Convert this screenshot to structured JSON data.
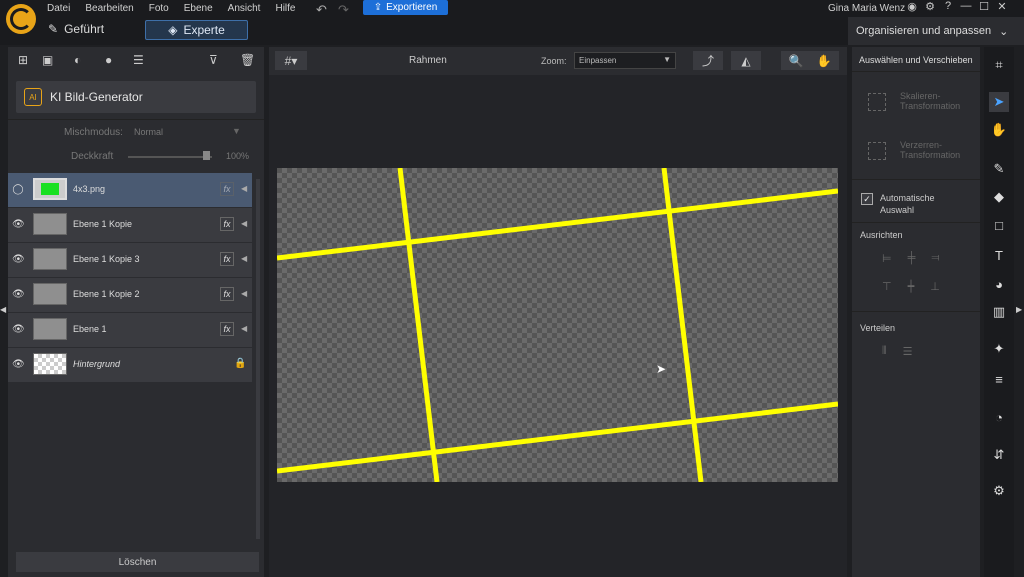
{
  "menu": {
    "items": [
      "Datei",
      "Bearbeiten",
      "Foto",
      "Ebene",
      "Ansicht",
      "Hilfe"
    ],
    "undo_icon": "undo-icon",
    "redo_icon": "redo-icon",
    "export_label": "Exportieren",
    "user_name": "Gina Maria Wenz"
  },
  "modes": {
    "guided": "Geführt",
    "expert": "Experte",
    "organize": "Organisieren und anpassen"
  },
  "left_panel": {
    "ki_button": "KI Bild-Generator",
    "ki_badge": "AI",
    "blend_label": "Mischmodus:",
    "blend_value": "Normal",
    "opacity_label": "Deckkraft",
    "opacity_value": "100%",
    "opacity_fraction": 1.0,
    "delete_label": "Löschen",
    "layers": [
      {
        "name": "4x3.png",
        "selected": true,
        "fx": "fx"
      },
      {
        "name": "Ebene 1 Kopie",
        "selected": false,
        "fx": "fx"
      },
      {
        "name": "Ebene 1 Kopie 3",
        "selected": false,
        "fx": "fx"
      },
      {
        "name": "Ebene 1 Kopie 2",
        "selected": false,
        "fx": "fx"
      },
      {
        "name": "Ebene 1",
        "selected": false,
        "fx": "fx"
      },
      {
        "name": "Hintergrund",
        "selected": false,
        "locked": true
      }
    ]
  },
  "center": {
    "title": "Rahmen",
    "zoom_label": "Zoom:",
    "zoom_value": "Einpassen"
  },
  "right_panel": {
    "title": "Auswählen und Verschieben",
    "scale_transform": "Skalieren-\nTransformation",
    "distort_transform": "Verzerren-\nTransformation",
    "auto_select": "Automatische\nAuswahl",
    "auto_select_checked": true,
    "align_section": "Ausrichten",
    "distribute_section": "Verteilen"
  },
  "colors": {
    "accent": "#1d6fd8",
    "frame_yellow": "#ffff00",
    "selection": "#4a5a72"
  }
}
